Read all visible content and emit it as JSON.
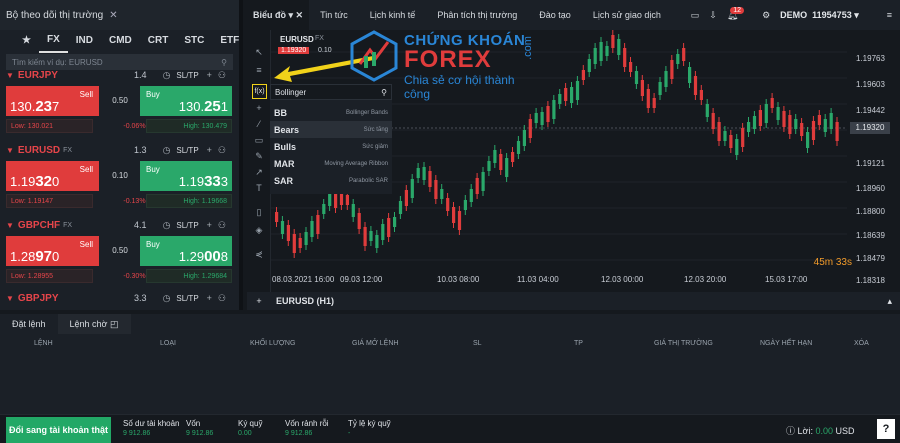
{
  "watchlist": {
    "title": "Bộ theo dõi thị trường",
    "close": "✕",
    "tabs": [
      "★",
      "FX",
      "IND",
      "CMD",
      "CRT",
      "STC",
      "ETF"
    ],
    "search_placeholder": "Tìm kiếm ví dụ: EURUSD",
    "instruments": [
      {
        "symbol": "EURJPY",
        "type": "FX",
        "spread": "1.4",
        "sltp": "SL/TP",
        "sell_label": "Sell",
        "buy_label": "Buy",
        "sell_a": "130.",
        "sell_b": "23",
        "sell_c": "7",
        "mid": "0.50",
        "buy_a": "130.",
        "buy_b": "25",
        "buy_c": "1",
        "low": "Low: 130.021",
        "change": "-0.06%",
        "high": "High: 130.479"
      },
      {
        "symbol": "EURUSD",
        "type": "FX",
        "spread": "1.3",
        "sltp": "SL/TP",
        "sell_label": "Sell",
        "buy_label": "Buy",
        "sell_a": "1.19",
        "sell_b": "32",
        "sell_c": "0",
        "mid": "0.10",
        "buy_a": "1.19",
        "buy_b": "33",
        "buy_c": "3",
        "low": "Low: 1.19147",
        "change": "-0.13%",
        "high": "High: 1.19668"
      },
      {
        "symbol": "GBPCHF",
        "type": "FX",
        "spread": "4.1",
        "sltp": "SL/TP",
        "sell_label": "Sell",
        "buy_label": "Buy",
        "sell_a": "1.28",
        "sell_b": "97",
        "sell_c": "0",
        "mid": "0.50",
        "buy_a": "1.29",
        "buy_b": "00",
        "buy_c": "8",
        "low": "Low: 1.28955",
        "change": "-0.30%",
        "high": "High: 1.29684"
      },
      {
        "symbol": "GBPJPY",
        "type": "FX",
        "spread": "3.3",
        "sltp": "SL/TP"
      }
    ]
  },
  "topbar": {
    "chart_tab": "Biểu đồ",
    "tabs": [
      "Tin tức",
      "Lịch kinh tế",
      "Phân tích thị trường",
      "Đào tạo",
      "Lịch sử giao dịch"
    ],
    "notifications": "12",
    "account_mode": "DEMO",
    "account_id": "11954753"
  },
  "chart": {
    "symbol": "EURUSD",
    "timeframe": "FX",
    "price_tag": "1.19320",
    "spread": "0.10",
    "current_price": "1.19320",
    "countdown": "45m 33s",
    "footer_title": "EURUSD (H1)",
    "y_ticks": [
      "1.19763",
      "1.19603",
      "1.19442",
      "1.19121",
      "1.18960",
      "1.18800",
      "1.18639",
      "1.18479",
      "1.18318"
    ],
    "x_ticks": [
      "08.03.2021 16:00",
      "09.03 12:00",
      "10.03 08:00",
      "11.03 04:00",
      "12.03 00:00",
      "12.03 20:00",
      "15.03 17:00"
    ]
  },
  "indicator_menu": {
    "search_value": "Bollinger",
    "items": [
      {
        "code": "BB",
        "desc": "Bollinger Bands"
      },
      {
        "code": "Bears",
        "desc": "Sức tăng"
      },
      {
        "code": "Bulls",
        "desc": "Sức giảm"
      },
      {
        "code": "MAR",
        "desc": "Moving Average Ribbon"
      },
      {
        "code": "SAR",
        "desc": "Parabolic SAR"
      }
    ]
  },
  "watermark": {
    "brand_top": "CHỨNG KHOÁN",
    "brand_main": "FOREX",
    "brand_tld": ".com",
    "tagline": "Chia sẻ cơ hội thành công"
  },
  "orders": {
    "tabs": [
      "Đặt lệnh",
      "Lệnh chờ"
    ],
    "columns": [
      "LỆNH",
      "LOẠI",
      "KHỐI LƯỢNG",
      "GIÁ MỞ LỆNH",
      "SL",
      "TP",
      "GIÁ THỊ TRƯỜNG",
      "NGÀY HẾT HẠN",
      "XÓA"
    ]
  },
  "account": {
    "real_button": "Đổi sang tài khoản thật",
    "fields": [
      {
        "label": "Số dư tài khoản",
        "value": "9 912.86"
      },
      {
        "label": "Vốn",
        "value": "9 912.86"
      },
      {
        "label": "Ký quỹ",
        "value": "0.00"
      },
      {
        "label": "Vốn rảnh rỗi",
        "value": "9 912.86"
      },
      {
        "label": "Tỷ lệ ký quỹ",
        "value": "-"
      }
    ],
    "profit_label": "Lời:",
    "profit_value": "0.00",
    "currency": "USD",
    "help": "?"
  },
  "colors": {
    "sell": "#e03c3c",
    "buy": "#2aa86a",
    "highlight": "#f1d21a",
    "countdown": "#f19a2a"
  }
}
